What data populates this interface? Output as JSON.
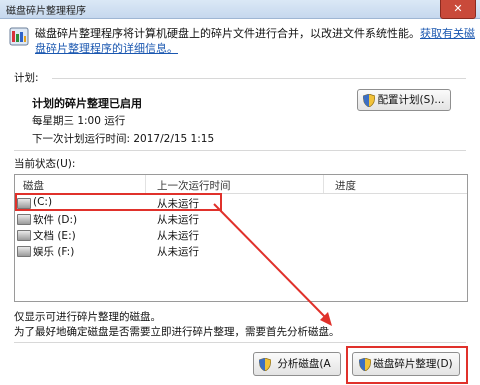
{
  "window": {
    "title": "磁盘碎片整理程序",
    "close_symbol": "✕"
  },
  "intro": {
    "text": "磁盘碎片整理程序将计算机硬盘上的碎片文件进行合并，以改进文件系统性能。",
    "link": "获取有关磁盘碎片整理程序的详细信息。"
  },
  "schedule": {
    "label": "计划:",
    "enabled_text": "计划的碎片整理已启用",
    "frequency": "每星期三 1:00 运行",
    "next_run": "下一次计划运行时间: 2017/2/15 1:15",
    "configure_button": "配置计划(S)..."
  },
  "status": {
    "label": "当前状态(U):",
    "columns": [
      "磁盘",
      "上一次运行时间",
      "进度"
    ],
    "rows": [
      {
        "disk": "(C:)",
        "last_run": "从未运行"
      },
      {
        "disk": "软件 (D:)",
        "last_run": "从未运行"
      },
      {
        "disk": "文档 (E:)",
        "last_run": "从未运行"
      },
      {
        "disk": "娱乐 (F:)",
        "last_run": "从未运行"
      }
    ]
  },
  "notes": {
    "line1": "仅显示可进行碎片整理的磁盘。",
    "line2": "为了最好地确定磁盘是否需要立即进行碎片整理，需要首先分析磁盘。"
  },
  "actions": {
    "analyze_button": "分析磁盘(A",
    "defrag_button": "磁盘碎片整理(D)"
  },
  "colors": {
    "annotation_red": "#e0312b"
  }
}
